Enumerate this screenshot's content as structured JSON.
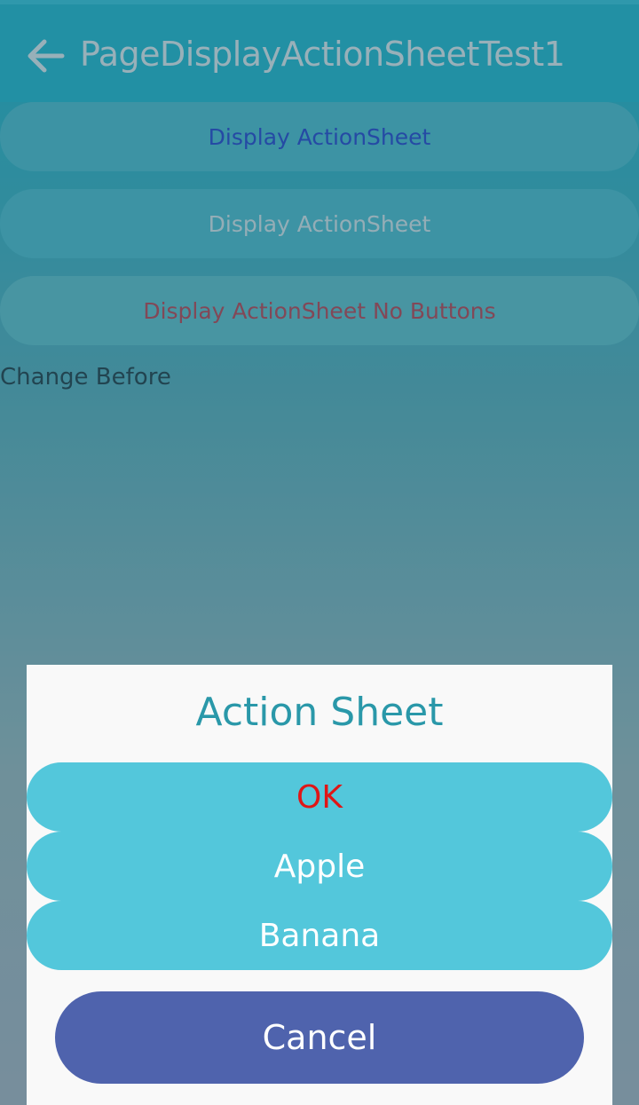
{
  "header": {
    "title": "PageDisplayActionSheetTest1",
    "back_icon": "arrow-left-icon"
  },
  "buttons": {
    "display_action_sheet_1": "Display ActionSheet",
    "display_action_sheet_2": "Display ActionSheet",
    "display_action_sheet_no_buttons": "Display ActionSheet No Buttons"
  },
  "status_label": "Change Before",
  "action_sheet": {
    "title": "Action Sheet",
    "options": [
      "OK",
      "Apple",
      "Banana"
    ],
    "cancel_label": "Cancel"
  },
  "colors": {
    "header": "#2bc3d8",
    "option_background": "#53c7db",
    "ok_text": "#e01616",
    "cancel_background": "#4f63ad",
    "sheet_title": "#2a98a9"
  }
}
